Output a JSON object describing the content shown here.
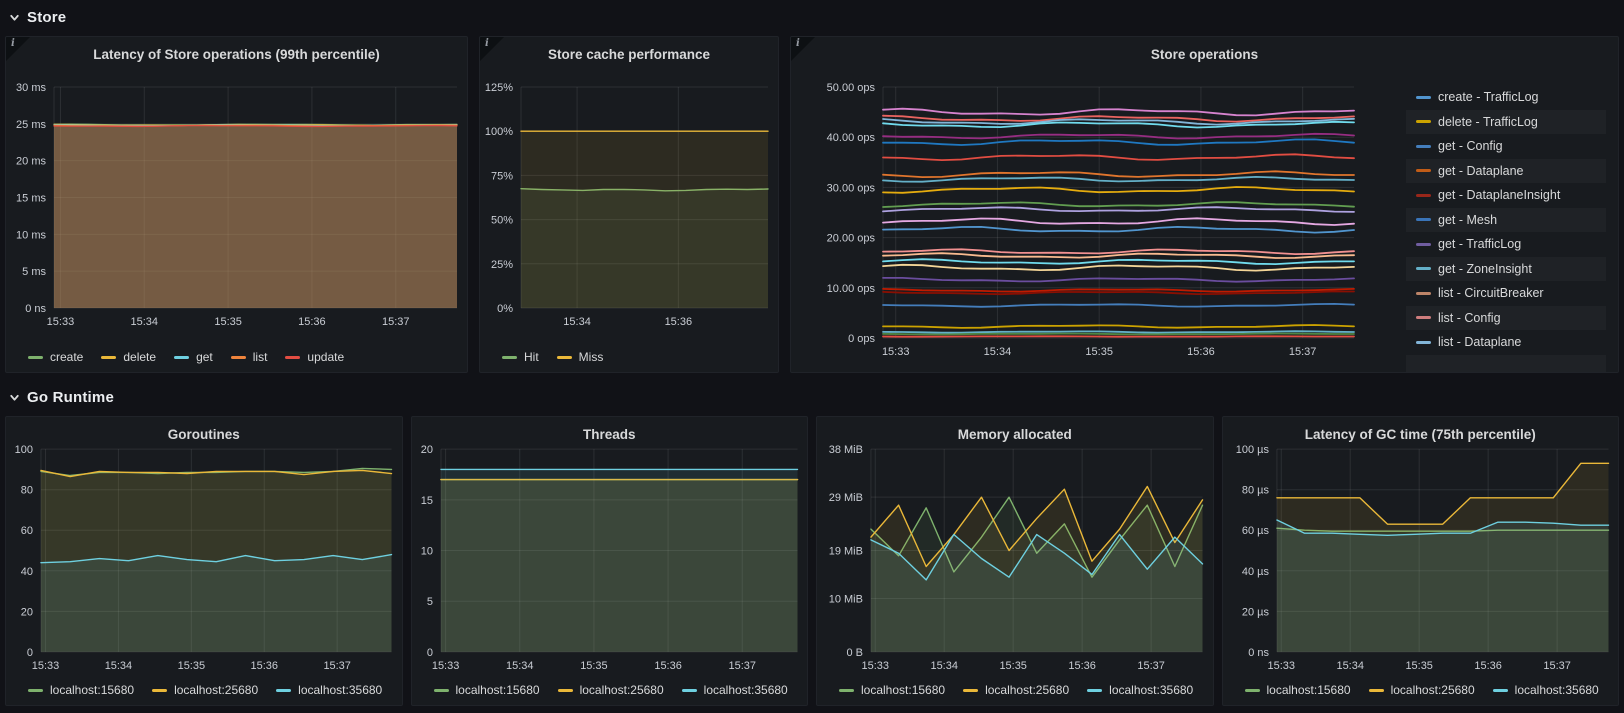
{
  "sections": [
    {
      "title": "Store",
      "chart_ids": [
        0,
        1,
        2
      ]
    },
    {
      "title": "Go Runtime",
      "chart_ids": [
        3,
        4,
        5,
        6
      ]
    }
  ],
  "chart_data": [
    {
      "type": "line",
      "title": "Latency of Store operations (99th percentile)",
      "info_icon": true,
      "ylim": [
        0,
        30
      ],
      "yticks": [
        {
          "v": 30,
          "label": "30 ms"
        },
        {
          "v": 25,
          "label": "25 ms"
        },
        {
          "v": 20,
          "label": "20 ms"
        },
        {
          "v": 15,
          "label": "15 ms"
        },
        {
          "v": 10,
          "label": "10 ms"
        },
        {
          "v": 5,
          "label": "5 ms"
        },
        {
          "v": 0,
          "label": "0 ns"
        }
      ],
      "xticks": [
        {
          "f": 0.016,
          "label": "15:33"
        },
        {
          "f": 0.224,
          "label": "15:34"
        },
        {
          "f": 0.432,
          "label": "15:35"
        },
        {
          "f": 0.64,
          "label": "15:36"
        },
        {
          "f": 0.848,
          "label": "15:37"
        }
      ],
      "fill_opacity": 0.15,
      "line_width": 1.2,
      "series": [
        {
          "name": "create",
          "color": "#7EB26D",
          "base": 24.9,
          "amp": 0.07
        },
        {
          "name": "delete",
          "color": "#EAB839",
          "base": 24.85,
          "amp": 0.07
        },
        {
          "name": "get",
          "color": "#6ED0E0",
          "base": 24.8,
          "amp": 0.07
        },
        {
          "name": "list",
          "color": "#EF843C",
          "base": 24.76,
          "amp": 0.07
        },
        {
          "name": "update",
          "color": "#E24D42",
          "base": 24.7,
          "amp": 0.07
        }
      ],
      "legend": {
        "position": "bottom",
        "items": [
          {
            "label": "create",
            "color": "#7EB26D"
          },
          {
            "label": "delete",
            "color": "#EAB839"
          },
          {
            "label": "get",
            "color": "#6ED0E0"
          },
          {
            "label": "list",
            "color": "#EF843C"
          },
          {
            "label": "update",
            "color": "#E24D42"
          }
        ]
      }
    },
    {
      "type": "line",
      "title": "Store cache performance",
      "info_icon": true,
      "ylim": [
        0,
        125
      ],
      "yticks": [
        {
          "v": 125,
          "label": "125%"
        },
        {
          "v": 100,
          "label": "100%"
        },
        {
          "v": 75,
          "label": "75%"
        },
        {
          "v": 50,
          "label": "50%"
        },
        {
          "v": 25,
          "label": "25%"
        },
        {
          "v": 0,
          "label": "0%"
        }
      ],
      "xticks": [
        {
          "f": 0.227,
          "label": "15:34"
        },
        {
          "f": 0.637,
          "label": "15:36"
        }
      ],
      "fill_opacity": 0.1,
      "line_width": 1.4,
      "series": [
        {
          "name": "Hit",
          "color": "#7EB26D",
          "values": [
            67.5,
            67,
            66.8,
            66.5,
            67,
            67,
            66.8,
            66.3,
            66.5,
            67,
            67.2,
            67,
            67.3
          ]
        },
        {
          "name": "Miss",
          "color": "#EAB839",
          "base": 100,
          "amp": 0
        }
      ],
      "legend": {
        "position": "bottom",
        "items": [
          {
            "label": "Hit",
            "color": "#7EB26D"
          },
          {
            "label": "Miss",
            "color": "#EAB839"
          }
        ]
      }
    },
    {
      "type": "line",
      "title": "Store operations",
      "info_icon": true,
      "ylim": [
        0,
        50
      ],
      "yticks": [
        {
          "v": 50,
          "label": "50.00 ops"
        },
        {
          "v": 40,
          "label": "40.00 ops"
        },
        {
          "v": 30,
          "label": "30.00 ops"
        },
        {
          "v": 20,
          "label": "20.00 ops"
        },
        {
          "v": 10,
          "label": "10.00 ops"
        },
        {
          "v": 0,
          "label": "0 ops"
        }
      ],
      "xticks": [
        {
          "f": 0.027,
          "label": "15:33"
        },
        {
          "f": 0.243,
          "label": "15:34"
        },
        {
          "f": 0.459,
          "label": "15:35"
        },
        {
          "f": 0.675,
          "label": "15:36"
        },
        {
          "f": 0.891,
          "label": "15:37"
        }
      ],
      "fill_opacity": 0,
      "line_width": 1.8,
      "series": [
        {
          "color": "#D683CE",
          "base": 45.0,
          "amp": 0.7
        },
        {
          "color": "#EA6460",
          "base": 43.7,
          "amp": 0.6
        },
        {
          "color": "#82B5D8",
          "base": 43.1,
          "amp": 0.6
        },
        {
          "color": "#70DBED",
          "base": 42.5,
          "amp": 0.6
        },
        {
          "color": "#962D82",
          "base": 40.2,
          "amp": 0.5
        },
        {
          "color": "#1F78C1",
          "base": 39.0,
          "amp": 0.6
        },
        {
          "color": "#E24D42",
          "base": 36.0,
          "amp": 0.6
        },
        {
          "color": "#E0752D",
          "base": 32.6,
          "amp": 0.6
        },
        {
          "color": "#64B0C8",
          "base": 31.6,
          "amp": 0.5
        },
        {
          "color": "#E5AC0E",
          "base": 29.5,
          "amp": 0.6
        },
        {
          "color": "#629E51",
          "base": 26.6,
          "amp": 0.5
        },
        {
          "color": "#AEA2E0",
          "base": 25.6,
          "amp": 0.5
        },
        {
          "color": "#E5A8E2",
          "base": 23.2,
          "amp": 0.7
        },
        {
          "color": "#5195CE",
          "base": 21.6,
          "amp": 0.6
        },
        {
          "color": "#F29191",
          "base": 17.2,
          "amp": 0.5
        },
        {
          "color": "#F9BA8F",
          "base": 16.4,
          "amp": 0.5
        },
        {
          "color": "#70DBED",
          "base": 15.2,
          "amp": 0.5
        },
        {
          "color": "#F4D598",
          "base": 14.0,
          "amp": 0.6
        },
        {
          "color": "#6A4D9E",
          "base": 11.6,
          "amp": 0.4
        },
        {
          "color": "#BF1B00",
          "base": 9.5,
          "amp": 0.3
        },
        {
          "color": "#890F02",
          "base": 9.0,
          "amp": 0.3
        },
        {
          "color": "#447EBC",
          "base": 6.5,
          "amp": 0.3
        },
        {
          "color": "#CCA300",
          "base": 2.3,
          "amp": 0.3
        },
        {
          "color": "#64B0C8",
          "base": 1.2,
          "amp": 0.15
        },
        {
          "color": "#508642",
          "base": 0.8,
          "amp": 0.1
        },
        {
          "color": "#E24D42",
          "base": 0.3,
          "amp": 0.05
        }
      ],
      "legend": {
        "position": "right",
        "items": [
          {
            "label": "create - TrafficLog",
            "color": "#5195CE"
          },
          {
            "label": "delete - TrafficLog",
            "color": "#CCA300"
          },
          {
            "label": "get - Config",
            "color": "#447EBC"
          },
          {
            "label": "get - Dataplane",
            "color": "#C15C17"
          },
          {
            "label": "get - DataplaneInsight",
            "color": "#99271A"
          },
          {
            "label": "get - Mesh",
            "color": "#3A74B8"
          },
          {
            "label": "get - TrafficLog",
            "color": "#705DA0"
          },
          {
            "label": "get - ZoneInsight",
            "color": "#64B0C8"
          },
          {
            "label": "list - CircuitBreaker",
            "color": "#BD8468"
          },
          {
            "label": "list - Config",
            "color": "#CE7D7D"
          },
          {
            "label": "list - Dataplane",
            "color": "#82B5D8"
          }
        ]
      }
    },
    {
      "type": "line",
      "title": "Goroutines",
      "info_icon": false,
      "ylim": [
        0,
        100
      ],
      "yticks": [
        {
          "v": 100,
          "label": "100"
        },
        {
          "v": 80,
          "label": "80"
        },
        {
          "v": 60,
          "label": "60"
        },
        {
          "v": 40,
          "label": "40"
        },
        {
          "v": 20,
          "label": "20"
        },
        {
          "v": 0,
          "label": "0"
        }
      ],
      "xticks": [
        {
          "f": 0.013,
          "label": "15:33"
        },
        {
          "f": 0.221,
          "label": "15:34"
        },
        {
          "f": 0.429,
          "label": "15:35"
        },
        {
          "f": 0.637,
          "label": "15:36"
        },
        {
          "f": 0.845,
          "label": "15:37"
        }
      ],
      "fill_opacity": 0.1,
      "line_width": 1.4,
      "series": [
        {
          "name": "localhost:15680",
          "color": "#7EB26D",
          "values": [
            89,
            87,
            88.5,
            88.5,
            88,
            88.5,
            88.5,
            89,
            89,
            88.5,
            89,
            90.5,
            90
          ]
        },
        {
          "name": "localhost:25680",
          "color": "#EAB839",
          "values": [
            89.5,
            86.5,
            89,
            88.5,
            88.5,
            88,
            89,
            89,
            89,
            87.5,
            89,
            89.5,
            88
          ]
        },
        {
          "name": "localhost:35680",
          "color": "#6ED0E0",
          "values": [
            44,
            44.5,
            46,
            45,
            47.5,
            45.5,
            44.5,
            47.5,
            45,
            45.5,
            47.5,
            45.5,
            48
          ]
        }
      ],
      "legend": {
        "position": "bottom",
        "items": [
          {
            "label": "localhost:15680",
            "color": "#7EB26D"
          },
          {
            "label": "localhost:25680",
            "color": "#EAB839"
          },
          {
            "label": "localhost:35680",
            "color": "#6ED0E0"
          }
        ]
      }
    },
    {
      "type": "line",
      "title": "Threads",
      "info_icon": false,
      "ylim": [
        0,
        20
      ],
      "yticks": [
        {
          "v": 20,
          "label": "20"
        },
        {
          "v": 15,
          "label": "15"
        },
        {
          "v": 10,
          "label": "10"
        },
        {
          "v": 5,
          "label": "5"
        },
        {
          "v": 0,
          "label": "0"
        }
      ],
      "xticks": [
        {
          "f": 0.013,
          "label": "15:33"
        },
        {
          "f": 0.221,
          "label": "15:34"
        },
        {
          "f": 0.429,
          "label": "15:35"
        },
        {
          "f": 0.637,
          "label": "15:36"
        },
        {
          "f": 0.845,
          "label": "15:37"
        }
      ],
      "fill_opacity": 0.1,
      "line_width": 1.4,
      "series": [
        {
          "name": "localhost:15680",
          "color": "#7EB26D",
          "base": 17,
          "amp": 0
        },
        {
          "name": "localhost:25680",
          "color": "#EAB839",
          "base": 17,
          "amp": 0
        },
        {
          "name": "localhost:35680",
          "color": "#6ED0E0",
          "base": 18,
          "amp": 0
        }
      ],
      "legend": {
        "position": "bottom",
        "items": [
          {
            "label": "localhost:15680",
            "color": "#7EB26D"
          },
          {
            "label": "localhost:25680",
            "color": "#EAB839"
          },
          {
            "label": "localhost:35680",
            "color": "#6ED0E0"
          }
        ]
      }
    },
    {
      "type": "line",
      "title": "Memory allocated",
      "info_icon": false,
      "ylim": [
        0,
        38
      ],
      "yticks": [
        {
          "v": 38,
          "label": "38 MiB"
        },
        {
          "v": 29,
          "label": "29 MiB"
        },
        {
          "v": 19,
          "label": "19 MiB"
        },
        {
          "v": 10,
          "label": "10 MiB"
        },
        {
          "v": 0,
          "label": "0 B"
        }
      ],
      "xticks": [
        {
          "f": 0.013,
          "label": "15:33"
        },
        {
          "f": 0.221,
          "label": "15:34"
        },
        {
          "f": 0.429,
          "label": "15:35"
        },
        {
          "f": 0.637,
          "label": "15:36"
        },
        {
          "f": 0.845,
          "label": "15:37"
        }
      ],
      "fill_opacity": 0.1,
      "line_width": 1.4,
      "series": [
        {
          "name": "localhost:15680",
          "color": "#7EB26D",
          "values": [
            23,
            18,
            27,
            15,
            21.5,
            29,
            18.5,
            24,
            14,
            21,
            27.5,
            16,
            27.5
          ]
        },
        {
          "name": "localhost:25680",
          "color": "#EAB839",
          "values": [
            21.5,
            27.5,
            16,
            22,
            29,
            19,
            25,
            30.5,
            17,
            23,
            31,
            20.5,
            28.5
          ]
        },
        {
          "name": "localhost:35680",
          "color": "#6ED0E0",
          "values": [
            21,
            18.5,
            13.5,
            22,
            17.5,
            14,
            22,
            18.5,
            14.5,
            22,
            15.5,
            21.5,
            16.5
          ]
        }
      ],
      "legend": {
        "position": "bottom",
        "items": [
          {
            "label": "localhost:15680",
            "color": "#7EB26D"
          },
          {
            "label": "localhost:25680",
            "color": "#EAB839"
          },
          {
            "label": "localhost:35680",
            "color": "#6ED0E0"
          }
        ]
      }
    },
    {
      "type": "line",
      "title": "Latency of GC time (75th percentile)",
      "info_icon": false,
      "ylim": [
        0,
        100
      ],
      "yticks": [
        {
          "v": 100,
          "label": "100 µs"
        },
        {
          "v": 80,
          "label": "80 µs"
        },
        {
          "v": 60,
          "label": "60 µs"
        },
        {
          "v": 40,
          "label": "40 µs"
        },
        {
          "v": 20,
          "label": "20 µs"
        },
        {
          "v": 0,
          "label": "0 ns"
        }
      ],
      "xticks": [
        {
          "f": 0.013,
          "label": "15:33"
        },
        {
          "f": 0.221,
          "label": "15:34"
        },
        {
          "f": 0.429,
          "label": "15:35"
        },
        {
          "f": 0.637,
          "label": "15:36"
        },
        {
          "f": 0.845,
          "label": "15:37"
        }
      ],
      "fill_opacity": 0.1,
      "line_width": 1.4,
      "series": [
        {
          "name": "localhost:15680",
          "color": "#7EB26D",
          "values": [
            61,
            60,
            59.5,
            59.5,
            59.5,
            59.5,
            59.5,
            59.5,
            60,
            60,
            60,
            60,
            60
          ]
        },
        {
          "name": "localhost:25680",
          "color": "#EAB839",
          "values": [
            76,
            76,
            76,
            76,
            63,
            63,
            63,
            76,
            76,
            76,
            76,
            93,
            93
          ]
        },
        {
          "name": "localhost:35680",
          "color": "#6ED0E0",
          "values": [
            65,
            58.5,
            58.5,
            58,
            57.5,
            58,
            58.5,
            58.5,
            64,
            64,
            63.5,
            62.5,
            62.5
          ]
        }
      ],
      "legend": {
        "position": "bottom",
        "items": [
          {
            "label": "localhost:15680",
            "color": "#7EB26D"
          },
          {
            "label": "localhost:25680",
            "color": "#EAB839"
          },
          {
            "label": "localhost:35680",
            "color": "#6ED0E0"
          }
        ]
      }
    }
  ]
}
